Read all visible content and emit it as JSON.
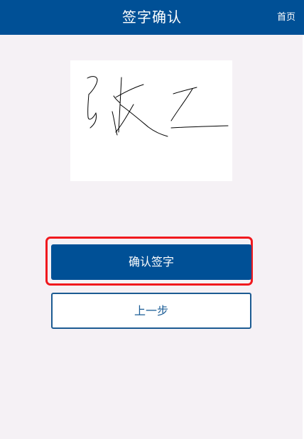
{
  "header": {
    "title": "签字确认",
    "home_link": "首页"
  },
  "signature": {
    "handwritten_text": "张三"
  },
  "actions": {
    "confirm_label": "确认签字",
    "back_label": "上一步"
  },
  "colors": {
    "primary": "#005096",
    "background": "#f5f1f5",
    "highlight": "#f0191e"
  }
}
